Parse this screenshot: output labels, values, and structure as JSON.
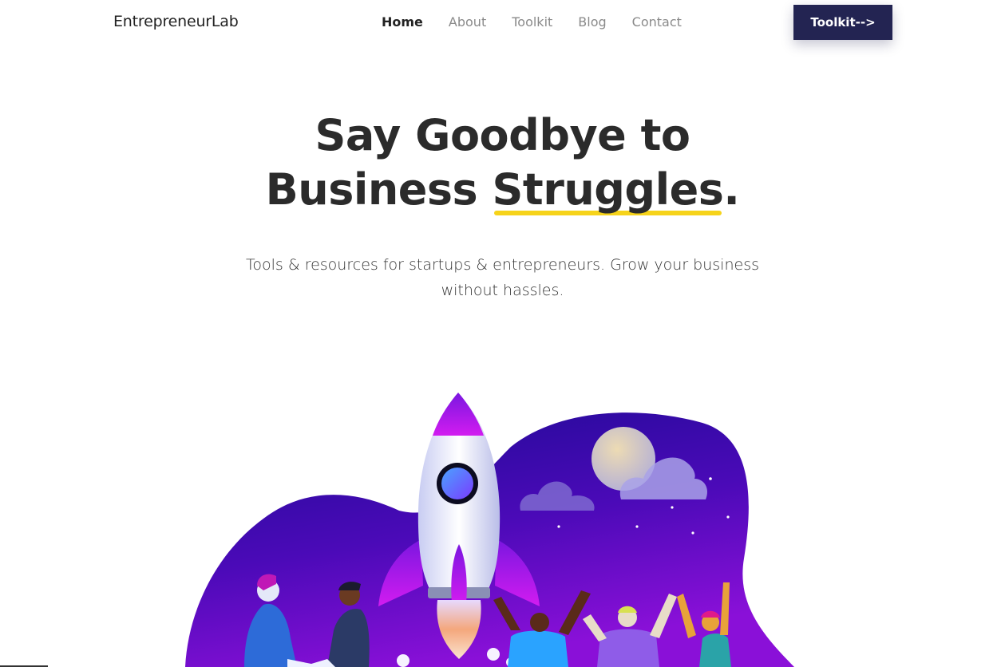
{
  "header": {
    "brand": "EntrepreneurLab",
    "nav": [
      {
        "label": "Home",
        "active": true
      },
      {
        "label": "About",
        "active": false
      },
      {
        "label": "Toolkit",
        "active": false
      },
      {
        "label": "Blog",
        "active": false
      },
      {
        "label": "Contact",
        "active": false
      }
    ],
    "cta_label": "Toolkit-->"
  },
  "hero": {
    "title_line1": "Say Goodbye to",
    "title_line2_prefix": "Business ",
    "title_highlight": "Struggles",
    "title_suffix": ".",
    "subtitle_line1": "Tools & resources for startups & entrepreneurs. Grow your business",
    "subtitle_line2": "without hassles."
  },
  "colors": {
    "cta_bg": "#232452",
    "highlight": "#f6d31a",
    "blob_dark": "#1f0a8f",
    "blob_mid": "#6a0fc9"
  },
  "illustration": {
    "icons": [
      "rocket-icon",
      "moon-icon",
      "cloud-icon",
      "people-illustration"
    ]
  }
}
